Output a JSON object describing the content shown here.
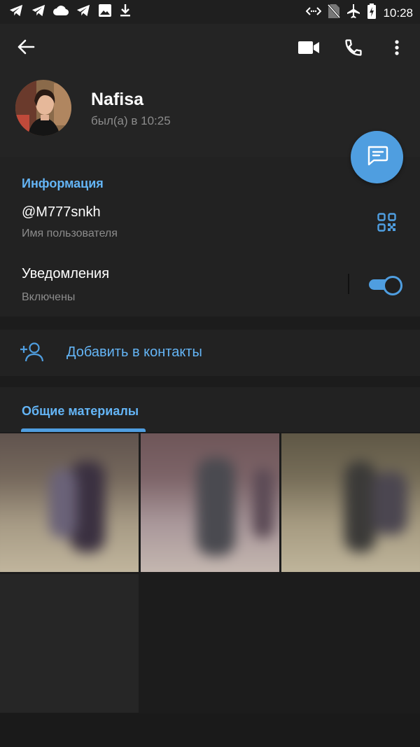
{
  "status_bar": {
    "time": "10:28",
    "left_icons": [
      "telegram-icon",
      "telegram-icon",
      "cloud-icon",
      "telegram-icon",
      "image-icon",
      "download-icon"
    ],
    "right_icons": [
      "data-saver-icon",
      "no-sim-icon",
      "airplane-icon",
      "battery-charging-icon"
    ]
  },
  "toolbar": {
    "back": "arrow-left-icon",
    "video_call": "video-call-icon",
    "voice_call": "phone-icon",
    "more": "more-vertical-icon"
  },
  "profile": {
    "name": "Nafisa",
    "status": "был(а) в 10:25"
  },
  "info": {
    "title": "Информация",
    "username": "@M777snkh",
    "username_label": "Имя пользователя",
    "notifications": "Уведомления",
    "notifications_state": "Включены",
    "notifications_enabled": true
  },
  "add_contact": {
    "label": "Добавить в контакты"
  },
  "media": {
    "tab_label": "Общие материалы"
  },
  "colors": {
    "accent": "#4f9ee0",
    "accent_text": "#64b5f6",
    "background": "#1c1c1c",
    "surface": "#222222"
  }
}
